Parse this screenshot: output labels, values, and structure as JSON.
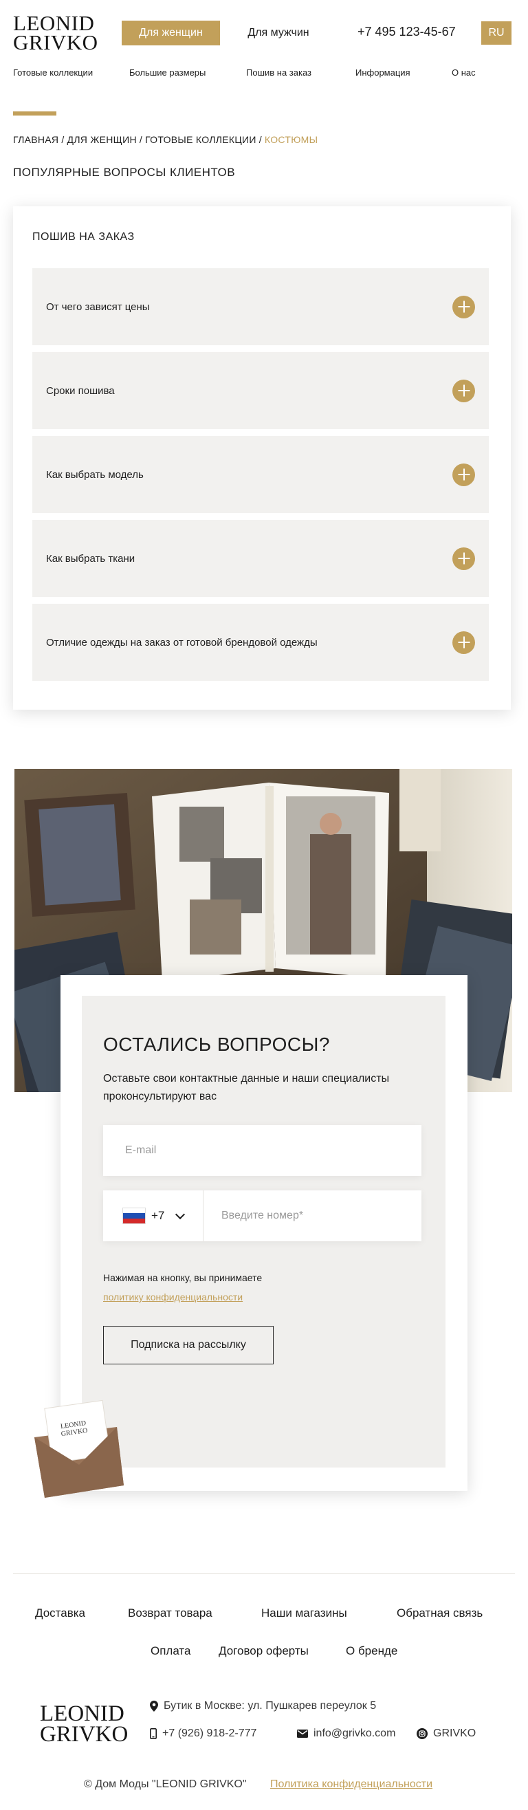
{
  "header": {
    "logo_line1": "LEONID",
    "logo_line2": "GRIVKO",
    "women_label": "Для женщин",
    "men_label": "Для мужчин",
    "phone": "+7 495 123-45-67",
    "lang": "RU",
    "nav": [
      "Готовые коллекции",
      "Большие размеры",
      "Пошив на заказ",
      "Информация",
      "О нас"
    ]
  },
  "breadcrumb": {
    "items": [
      "ГЛАВНАЯ",
      "ДЛЯ ЖЕНЩИН",
      "ГОТОВЫЕ КОЛЛЕКЦИИ"
    ],
    "current": "КОСТЮМЫ",
    "separator": "/"
  },
  "faq": {
    "title": "ПОПУЛЯРНЫЕ ВОПРОСЫ КЛИЕНТОВ",
    "section": "ПОШИВ НА ЗАКАЗ",
    "items": [
      "От чего зависят цены",
      "Сроки пошива",
      "Как выбрать модель",
      "Как выбрать ткани",
      "Отличие одежды на заказ от готовой брендовой одежды"
    ]
  },
  "form": {
    "title": "ОСТАЛИСЬ ВОПРОСЫ?",
    "description": "Оставьте свои контактные данные и наши специалисты проконсультируют вас",
    "email_placeholder": "E-mail",
    "country_code": "+7",
    "phone_placeholder": "Введите номер*",
    "agree_text": "Нажимая на кнопку, вы принимаете",
    "policy_link": "политику конфиденциальности",
    "submit_label": "Подписка на рассылку"
  },
  "footer": {
    "links_row1": [
      "Доставка",
      "Возврат товара",
      "Наши магазины",
      "Обратная связь"
    ],
    "links_row2": [
      "Оплата",
      "Договор оферты",
      "О бренде"
    ],
    "address": "Бутик в Москве: ул. Пушкарев переулок 5",
    "phone": "+7 (926) 918-2-777",
    "email": "info@grivko.com",
    "social": "GRIVKO",
    "copyright": "© Дом Моды \"LEONID GRIVKO\"",
    "privacy": "Политика конфиденциальности"
  },
  "colors": {
    "accent": "#c2a05a",
    "text": "#1e1e1e",
    "panel": "#f2f1ef"
  }
}
